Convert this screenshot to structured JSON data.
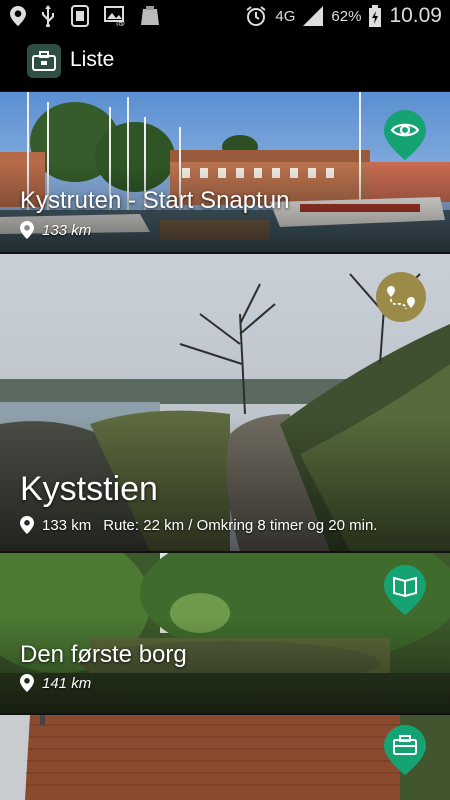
{
  "status_bar": {
    "network": "4G",
    "battery": "62%",
    "time": "10.09",
    "icons": [
      "location-icon",
      "usb-icon",
      "sim-icon",
      "image-icon",
      "clipboard-icon",
      "alarm-icon",
      "signal-icon",
      "battery-icon"
    ]
  },
  "app_bar": {
    "title": "Liste",
    "icon": "toolbox-icon"
  },
  "items": [
    {
      "name": "Kystruten - Start Snaptun",
      "distance": "133 km",
      "route": "",
      "badge": "eye-icon",
      "badge_color": "#15a374"
    },
    {
      "name": "Kyststien",
      "distance": "133 km",
      "route": "Rute: 22 km / Omkring 8 timer og 20 min.",
      "badge": "route-icon",
      "badge_color": "#9c8a48"
    },
    {
      "name": "Den første borg",
      "distance": "141 km",
      "route": "",
      "badge": "book-icon",
      "badge_color": "#15a374"
    },
    {
      "name": "",
      "distance": "",
      "route": "",
      "badge": "toolbox-icon",
      "badge_color": "#15a374"
    }
  ]
}
